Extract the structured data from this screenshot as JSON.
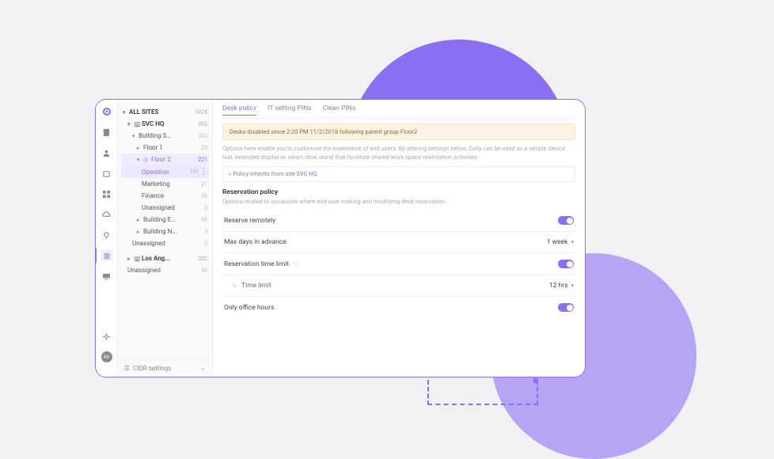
{
  "iconbar": {
    "avatar_text": "AV"
  },
  "sidebar": {
    "all_sites": {
      "label": "ALL SITES",
      "count": "1024"
    },
    "svc_hq": {
      "label": "SVC HQ",
      "count": "302"
    },
    "building_s": {
      "label": "Building S...",
      "count": "302"
    },
    "floor1": {
      "label": "Floor 1",
      "count": "23"
    },
    "floor2": {
      "label": "Floor 2",
      "count": "221"
    },
    "operation": {
      "label": "Operation",
      "count": "151"
    },
    "marketing": {
      "label": "Marketing",
      "count": "21"
    },
    "finance": {
      "label": "Finance",
      "count": "56"
    },
    "unassigned_f2": {
      "label": "Unassigned",
      "count": "3"
    },
    "building_e": {
      "label": "Building E...",
      "count": "56"
    },
    "building_n": {
      "label": "Building N...",
      "count": "3"
    },
    "unassigned_svc": {
      "label": "Unassigned",
      "count": "3"
    },
    "los_ang": {
      "label": "Los Ang...",
      "count": "202"
    },
    "unassigned_all": {
      "label": "Unassigned",
      "count": "50"
    },
    "cidr": {
      "label": "CIDR settings"
    }
  },
  "tabs": {
    "desk_policy": "Desk policy",
    "it_pins": "IT setting PINs",
    "clean_pins": "Clean PINs"
  },
  "banner": {
    "text": "Desks disabled since 2:20 PM 11/2/2018 following parent group Floor2"
  },
  "description": "Options here enable you to customize the experience of end users. By altering settings below, Colly can be used as a simple device hub, extended display or smart desk stand that facilitate shared work space reservation activities.",
  "inherit": {
    "prefix": "Policy inherits from site ",
    "link": "SVC HQ"
  },
  "section": {
    "title": "Reservation policy",
    "desc": "Options related to occasions where end-user making and modifying desk reservation."
  },
  "settings": {
    "reserve_remotely": {
      "label": "Reserve remotely"
    },
    "max_days": {
      "label": "Max days in advance",
      "value": "1 week"
    },
    "res_time_limit": {
      "label": "Reservation time limit"
    },
    "time_limit": {
      "label": "Time limit",
      "value": "12 hrs"
    },
    "office_hours": {
      "label": "Only office hours"
    }
  }
}
